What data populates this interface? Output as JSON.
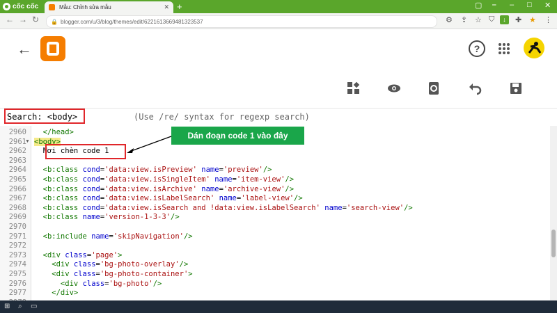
{
  "browser": {
    "brand_name": "cốc cốc",
    "tab_title": "Mẫu: Chỉnh sửa mẫu",
    "url": "blogger.com/u/3/blog/themes/edit/6221613669481323537"
  },
  "editor": {
    "search_label": "Search: <body>",
    "search_hint": "(Use /re/ syntax for regexp search)",
    "annotation": "Dán đoạn code 1 vào đây",
    "lines": [
      {
        "n": "2960",
        "text": "  </head>"
      },
      {
        "n": "2961",
        "text": "<body>"
      },
      {
        "n": "2962",
        "text": "  Nơi chèn code 1"
      },
      {
        "n": "2963",
        "text": ""
      },
      {
        "n": "2964",
        "pre": "  <",
        "tag": "b:class",
        "a1": "cond",
        "v1": "'data:view.isPreview'",
        "a2": "name",
        "v2": "'preview'",
        "end": "/>"
      },
      {
        "n": "2965",
        "pre": "  <",
        "tag": "b:class",
        "a1": "cond",
        "v1": "'data:view.isSingleItem'",
        "a2": "name",
        "v2": "'item-view'",
        "end": "/>"
      },
      {
        "n": "2966",
        "pre": "  <",
        "tag": "b:class",
        "a1": "cond",
        "v1": "'data:view.isArchive'",
        "a2": "name",
        "v2": "'archive-view'",
        "end": "/>"
      },
      {
        "n": "2967",
        "pre": "  <",
        "tag": "b:class",
        "a1": "cond",
        "v1": "'data:view.isLabelSearch'",
        "a2": "name",
        "v2": "'label-view'",
        "end": "/>"
      },
      {
        "n": "2968",
        "pre": "  <",
        "tag": "b:class",
        "a1": "cond",
        "v1": "'data:view.isSearch and !data:view.isLabelSearch'",
        "a2": "name",
        "v2": "'search-view'",
        "end": "/>"
      },
      {
        "n": "2969",
        "pre": "  <",
        "tag": "b:class",
        "a1": "name",
        "v1": "'version-1-3-3'",
        "a2": "",
        "v2": "",
        "end": "/>"
      },
      {
        "n": "2970",
        "text": ""
      },
      {
        "n": "2971",
        "pre": "  <",
        "tag": "b:include",
        "a1": "name",
        "v1": "'skipNavigation'",
        "a2": "",
        "v2": "",
        "end": "/>"
      },
      {
        "n": "2972",
        "text": ""
      },
      {
        "n": "2973",
        "pre": "  <",
        "tag": "div",
        "a1": "class",
        "v1": "'page'",
        "a2": "",
        "v2": "",
        "end": ">"
      },
      {
        "n": "2974",
        "pre": "    <",
        "tag": "div",
        "a1": "class",
        "v1": "'bg-photo-overlay'",
        "a2": "",
        "v2": "",
        "end": "/>"
      },
      {
        "n": "2975",
        "pre": "    <",
        "tag": "div",
        "a1": "class",
        "v1": "'bg-photo-container'",
        "a2": "",
        "v2": "",
        "end": ">"
      },
      {
        "n": "2976",
        "pre": "      <",
        "tag": "div",
        "a1": "class",
        "v1": "'bg-photo'",
        "a2": "",
        "v2": "",
        "end": "/>"
      },
      {
        "n": "2977",
        "text": "    </div>"
      },
      {
        "n": "2978",
        "text": ""
      }
    ]
  },
  "colors": {
    "accent_green": "#5aa62b",
    "callout_green": "#1aa64a",
    "highlight_red": "#e0262a",
    "blogger_orange": "#f57d00"
  }
}
